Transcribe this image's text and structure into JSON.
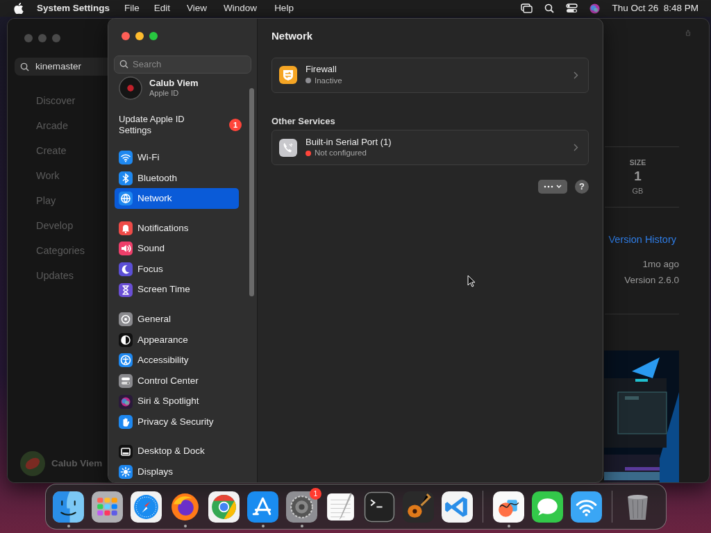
{
  "menubar": {
    "app": "System Settings",
    "menus": [
      "File",
      "Edit",
      "View",
      "Window",
      "Help"
    ],
    "clock": "Thu Oct 26  8:48 PM"
  },
  "background_window": {
    "search": {
      "value": "kinemaster"
    },
    "nav": [
      "Discover",
      "Arcade",
      "Create",
      "Work",
      "Play",
      "Develop",
      "Categories",
      "Updates"
    ],
    "user": "Calub Viem",
    "details": {
      "size_label": "SIZE",
      "size_value": "1",
      "size_unit": "GB",
      "version_history": "Version History",
      "updated": "1mo ago",
      "version": "Version 2.6.0"
    }
  },
  "settings": {
    "search": {
      "placeholder": "Search"
    },
    "account": {
      "name": "Calub Viem",
      "subtitle": "Apple ID"
    },
    "notice": {
      "text": "Update Apple ID Settings",
      "badge": "1"
    },
    "sidebar_groups": [
      {
        "items": [
          {
            "label": "Wi-Fi",
            "selected": false
          },
          {
            "label": "Bluetooth",
            "selected": false
          },
          {
            "label": "Network",
            "selected": true
          }
        ]
      },
      {
        "items": [
          {
            "label": "Notifications",
            "selected": false
          },
          {
            "label": "Sound",
            "selected": false
          },
          {
            "label": "Focus",
            "selected": false
          },
          {
            "label": "Screen Time",
            "selected": false
          }
        ]
      },
      {
        "items": [
          {
            "label": "General",
            "selected": false
          },
          {
            "label": "Appearance",
            "selected": false
          },
          {
            "label": "Accessibility",
            "selected": false
          },
          {
            "label": "Control Center",
            "selected": false
          },
          {
            "label": "Siri & Spotlight",
            "selected": false
          },
          {
            "label": "Privacy & Security",
            "selected": false
          }
        ]
      },
      {
        "items": [
          {
            "label": "Desktop & Dock",
            "selected": false
          },
          {
            "label": "Displays",
            "selected": false
          }
        ]
      }
    ],
    "title": "Network",
    "services": [
      {
        "name": "Firewall",
        "status": "Inactive",
        "color": "#8e8e93"
      }
    ],
    "other_heading": "Other Services",
    "other_services": [
      {
        "name": "Built-in Serial Port (1)",
        "status": "Not configured",
        "color": "#ff453a"
      }
    ],
    "help": "?"
  },
  "dock": {
    "items": [
      {
        "kind": "app",
        "running": true
      },
      {
        "kind": "app",
        "running": false
      },
      {
        "kind": "app",
        "running": false
      },
      {
        "kind": "app",
        "running": true
      },
      {
        "kind": "app",
        "running": false
      },
      {
        "kind": "app",
        "running": true
      },
      {
        "kind": "app",
        "running": true,
        "badge": "1"
      },
      {
        "kind": "app",
        "running": false
      },
      {
        "kind": "app",
        "running": false
      },
      {
        "kind": "app",
        "running": false
      },
      {
        "kind": "app",
        "running": false
      },
      {
        "kind": "separator"
      },
      {
        "kind": "app",
        "running": true
      },
      {
        "kind": "app",
        "running": false
      },
      {
        "kind": "app",
        "running": false
      },
      {
        "kind": "separator"
      },
      {
        "kind": "app",
        "running": false
      }
    ]
  }
}
